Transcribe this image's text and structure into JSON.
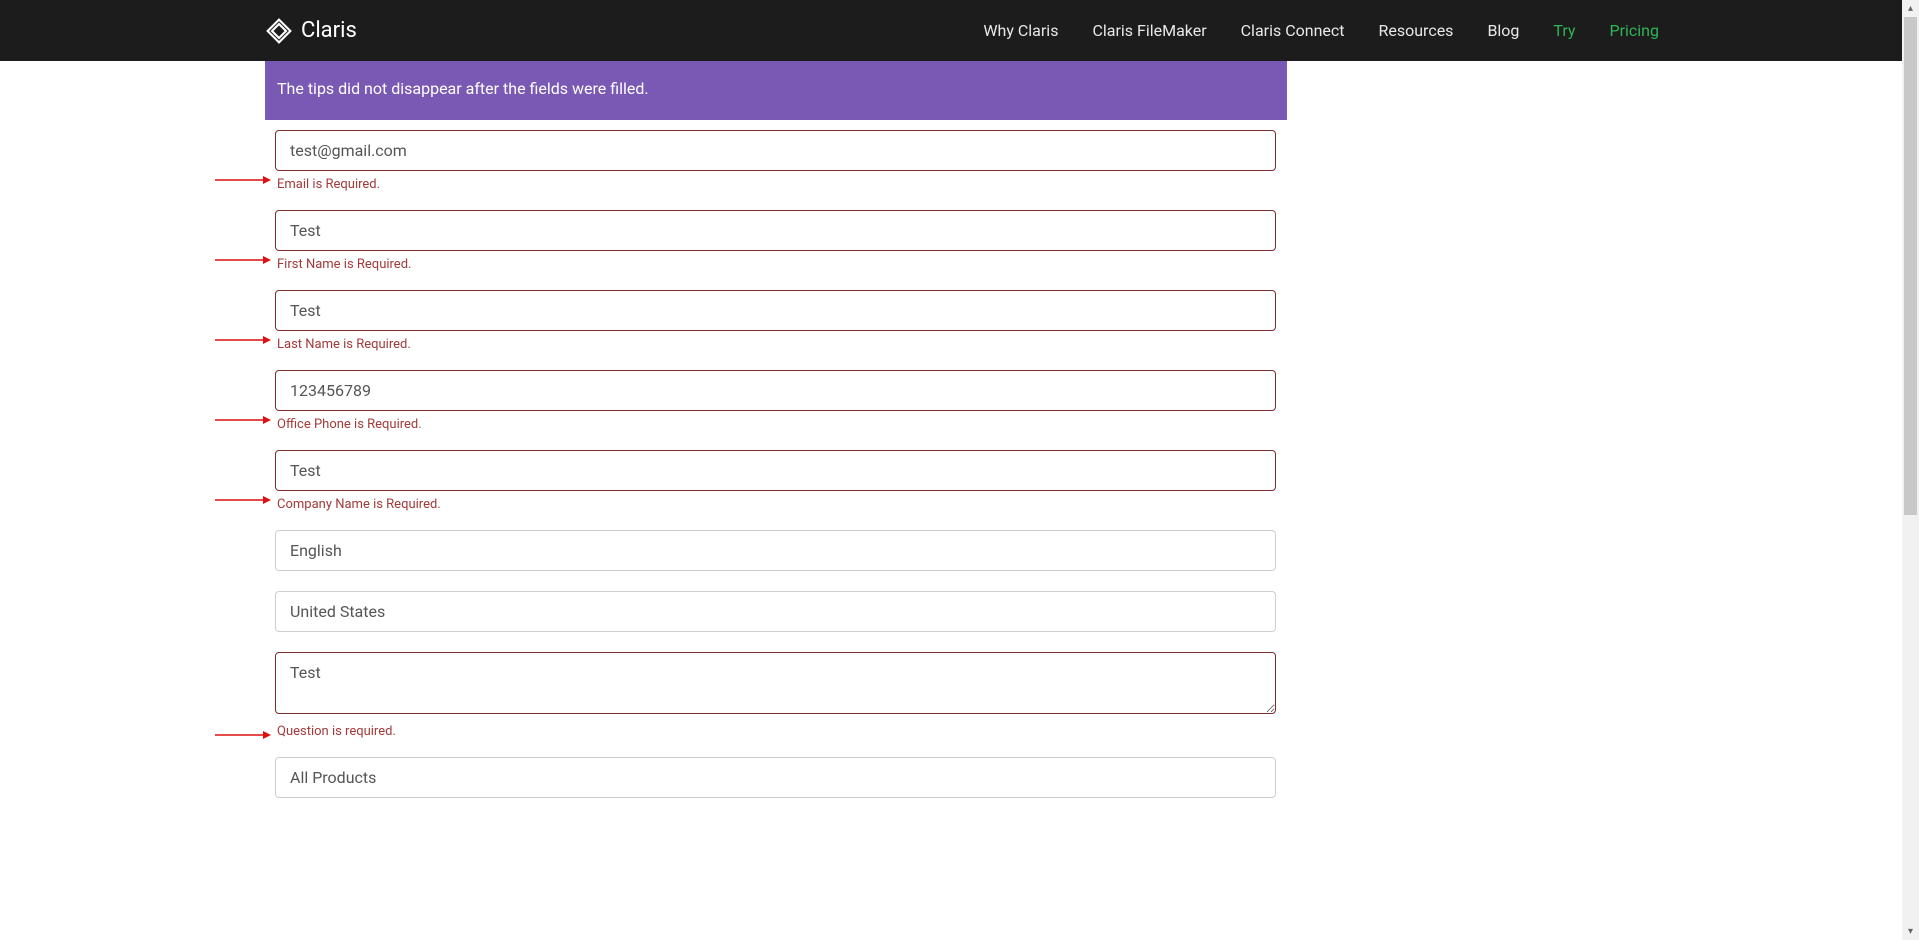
{
  "nav": {
    "brand": "Claris",
    "links": [
      {
        "label": "Why Claris",
        "accent": false
      },
      {
        "label": "Claris FileMaker",
        "accent": false
      },
      {
        "label": "Claris Connect",
        "accent": false
      },
      {
        "label": "Resources",
        "accent": false
      },
      {
        "label": "Blog",
        "accent": false
      },
      {
        "label": "Try",
        "accent": true
      },
      {
        "label": "Pricing",
        "accent": true
      }
    ]
  },
  "banner": {
    "text": "The tips did not disappear after the fields were filled.",
    "bg": "#7a59b4"
  },
  "form": {
    "email": {
      "value": "test@gmail.com",
      "error": "Email is Required."
    },
    "first_name": {
      "value": "Test",
      "error": "First Name is Required."
    },
    "last_name": {
      "value": "Test",
      "error": "Last Name is Required."
    },
    "office_phone": {
      "value": "123456789",
      "error": "Office Phone is Required."
    },
    "company_name": {
      "value": "Test",
      "error": "Company Name is Required."
    },
    "language": {
      "value": "English"
    },
    "country": {
      "value": "United States"
    },
    "question": {
      "value": "Test",
      "error": "Question is required."
    },
    "product": {
      "value": "All Products"
    }
  },
  "colors": {
    "error_text": "#a33a3a",
    "error_border": "#7a2d2d",
    "accent_green": "#2fb457",
    "navbar_bg": "#1c1c1c"
  },
  "icons": {
    "brand": "claris-logo-icon",
    "annotation": "red-arrow-icon",
    "scroll_up": "scroll-up-icon",
    "scroll_down": "scroll-down-icon"
  }
}
